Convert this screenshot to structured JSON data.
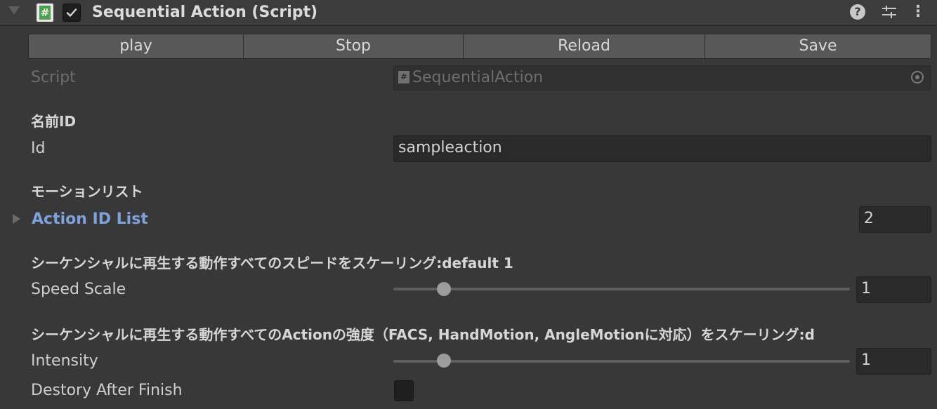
{
  "component": {
    "title": "Sequential Action (Script)",
    "enabled": true,
    "header_icons": [
      "script-icon",
      "help-icon",
      "preset-icon",
      "more-icon"
    ]
  },
  "toolbar": {
    "buttons": [
      "play",
      "Stop",
      "Reload",
      "Save"
    ]
  },
  "script_field": {
    "label": "Script",
    "value": "SequentialAction"
  },
  "id_section": {
    "header": "名前ID",
    "label": "Id",
    "value": "sampleaction"
  },
  "motion_section": {
    "header": "モーションリスト",
    "foldout_label": "Action ID List",
    "count": "2"
  },
  "speed_section": {
    "header": "シーケンシャルに再生する動作すべてのスピードをスケーリング:default 1",
    "label": "Speed Scale",
    "value": "1",
    "slider_fraction": 0.11
  },
  "intensity_section": {
    "header": "シーケンシャルに再生する動作すべてのActionの強度（FACS, HandMotion, AngleMotionに対応）をスケーリング:d",
    "label": "Intensity",
    "value": "1",
    "slider_fraction": 0.11
  },
  "destroy_field": {
    "label": "Destory After Finish",
    "checked": false
  },
  "colors": {
    "background": "#383838",
    "field": "#2a2a2a",
    "foldout_label": "#7ea2dc",
    "script_icon": "#4f9e52"
  }
}
